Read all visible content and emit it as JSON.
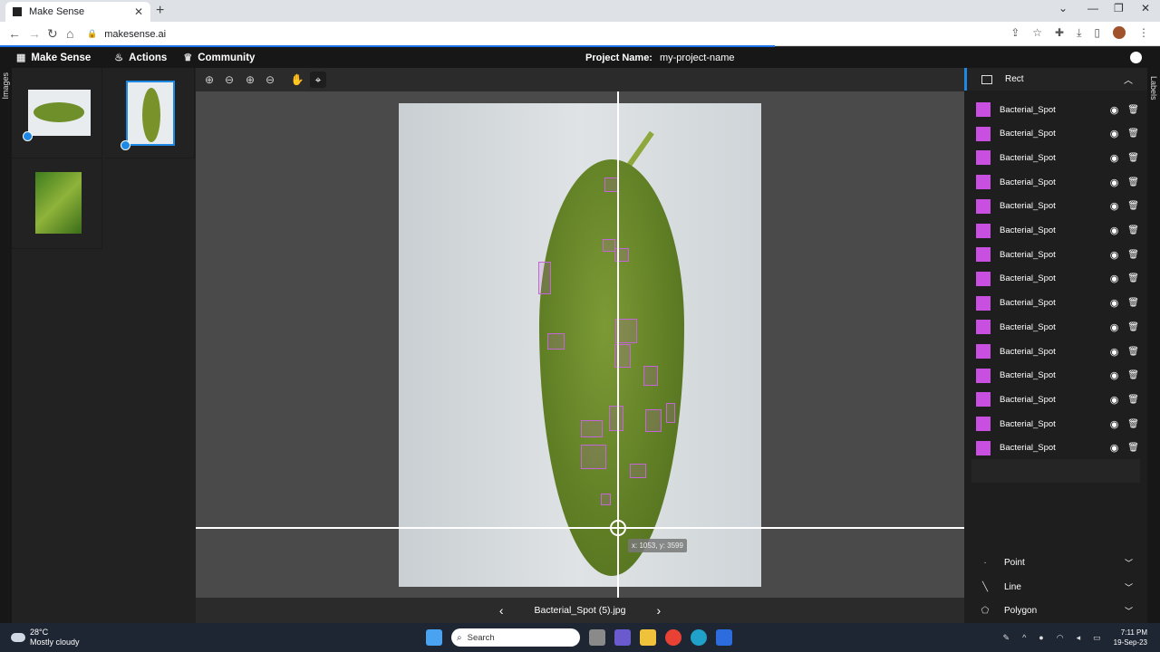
{
  "browser": {
    "tab_title": "Make Sense",
    "url": "makesense.ai"
  },
  "app": {
    "brand": "Make Sense",
    "menu": [
      "Actions",
      "Community"
    ],
    "project_label": "Project Name:",
    "project_name": "my-project-name"
  },
  "side": {
    "images_label": "Images",
    "labels_label": "Labels"
  },
  "canvas": {
    "coordinate_readout": "x: 1053, y: 3599",
    "file_name": "Bacterial_Spot (5).jpg"
  },
  "labels_panel": {
    "header": "Rect",
    "accent_color": "#1e88e5",
    "label_color": "#c94fe0",
    "items": [
      "Bacterial_Spot",
      "Bacterial_Spot",
      "Bacterial_Spot",
      "Bacterial_Spot",
      "Bacterial_Spot",
      "Bacterial_Spot",
      "Bacterial_Spot",
      "Bacterial_Spot",
      "Bacterial_Spot",
      "Bacterial_Spot",
      "Bacterial_Spot",
      "Bacterial_Spot",
      "Bacterial_Spot",
      "Bacterial_Spot",
      "Bacterial_Spot"
    ],
    "tools": [
      "Point",
      "Line",
      "Polygon"
    ]
  },
  "taskbar": {
    "temperature": "28°C",
    "weather": "Mostly cloudy",
    "search_placeholder": "Search",
    "time": "7:11 PM",
    "date": "19-Sep-23"
  }
}
